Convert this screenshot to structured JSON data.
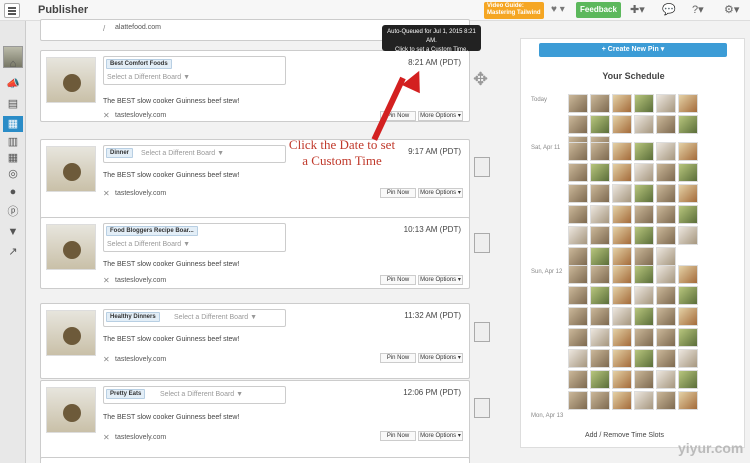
{
  "app": {
    "title": "Publisher",
    "video_guide": "Video Guide: Mastering Tailwind",
    "feedback": "Feedback"
  },
  "tooltip": {
    "line1": "Auto-Queued for Jul 1, 2015 8:21 AM.",
    "line2": "Click to set a Custom Time."
  },
  "annotation": "Click the Date to set a Custom Time",
  "first_url": "alattefood.com",
  "pins": [
    {
      "tag": "Best Comfort Foods",
      "placeholder": "Select a Different Board ▼",
      "desc": "The BEST slow cooker Guinness beef stew!",
      "url": "tasteslovely.com",
      "time": "8:21 AM (PDT)"
    },
    {
      "tag": "Dinner",
      "placeholder": "Select a Different Board ▼",
      "desc": "The BEST slow cooker Guinness beef stew!",
      "url": "tasteslovely.com",
      "time": "9:17 AM (PDT)"
    },
    {
      "tag": "Food Bloggers Recipe Boar...",
      "placeholder": "Select a Different Board ▼",
      "desc": "The BEST slow cooker Guinness beef stew!",
      "url": "tasteslovely.com",
      "time": "10:13 AM (PDT)"
    },
    {
      "tag": "Healthy Dinners",
      "placeholder": "Select a Different Board ▼",
      "desc": "The BEST slow cooker Guinness beef stew!",
      "url": "tasteslovely.com",
      "time": "11:32 AM (PDT)"
    },
    {
      "tag": "Pretty Eats",
      "placeholder": "Select a Different Board ▼",
      "desc": "The BEST slow cooker Guinness beef stew!",
      "url": "tasteslovely.com",
      "time": "12:06 PM (PDT)"
    }
  ],
  "buttons": {
    "pin_now": "Pin Now",
    "more": "More Options ▾"
  },
  "schedule": {
    "create": "+ Create New Pin ▾",
    "title": "Your Schedule",
    "days": [
      "Today",
      "Sat, Apr 11",
      "Sun, Apr 12",
      "Mon, Apr 13"
    ],
    "add": "Add / Remove Time Slots"
  },
  "watermark": "yiyur.com"
}
